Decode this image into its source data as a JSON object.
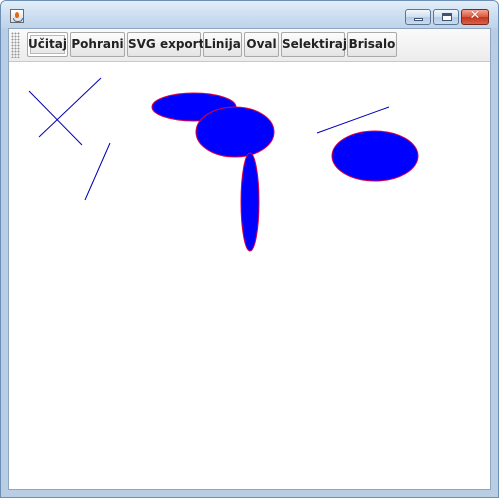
{
  "window": {
    "icon": "java-cup-icon",
    "controls": {
      "minimize_icon": "minimize-icon",
      "maximize_icon": "maximize-icon",
      "close_icon": "close-icon",
      "close_glyph": "✕"
    }
  },
  "toolbar": {
    "buttons": [
      {
        "label": "Učitaj"
      },
      {
        "label": "Pohrani"
      },
      {
        "label": "SVG export"
      },
      {
        "label": "Linija"
      },
      {
        "label": "Oval"
      },
      {
        "label": "Selektiraj"
      },
      {
        "label": "Brisalo"
      }
    ]
  },
  "canvas": {
    "line_color": "#0000b4",
    "oval_fill": "#0000ff",
    "oval_stroke": "#e00040",
    "line_count": 4,
    "oval_count": 4
  }
}
